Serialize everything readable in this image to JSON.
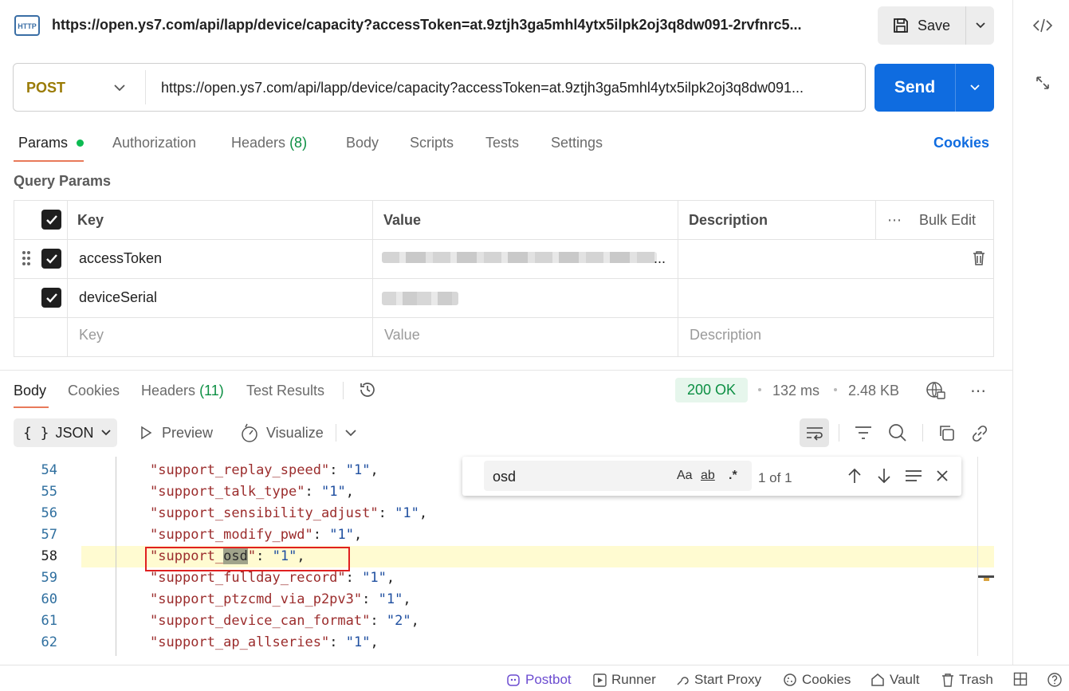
{
  "title_bar": {
    "url": "https://open.ys7.com/api/lapp/device/capacity?accessToken=at.9ztjh3ga5mhl4ytx5ilpk2oj3q8dw091-2rvfnrc5...",
    "badge_text": "HTTP",
    "save_label": "Save"
  },
  "request": {
    "method": "POST",
    "url": "https://open.ys7.com/api/lapp/device/capacity?accessToken=at.9ztjh3ga5mhl4ytx5ilpk2oj3q8dw091...",
    "send_label": "Send"
  },
  "request_tabs": {
    "params": "Params",
    "authorization": "Authorization",
    "headers": "Headers",
    "headers_count": "(8)",
    "body": "Body",
    "scripts": "Scripts",
    "tests": "Tests",
    "settings": "Settings",
    "cookies": "Cookies"
  },
  "query_params": {
    "title": "Query Params",
    "headers": {
      "key": "Key",
      "value": "Value",
      "description": "Description",
      "bulk_edit": "Bulk Edit"
    },
    "rows": [
      {
        "key": "accessToken",
        "value_suffix": "..."
      },
      {
        "key": "deviceSerial"
      }
    ],
    "placeholder": {
      "key": "Key",
      "value": "Value",
      "description": "Description"
    }
  },
  "response": {
    "tabs": {
      "body": "Body",
      "cookies": "Cookies",
      "headers": "Headers",
      "headers_count": "(11)",
      "test_results": "Test Results"
    },
    "status": "200 OK",
    "time": "132 ms",
    "size": "2.48 KB",
    "format": "JSON",
    "preview": "Preview",
    "visualize": "Visualize"
  },
  "code_lines": [
    {
      "n": "54",
      "key": "support_replay_speed",
      "val": "1"
    },
    {
      "n": "55",
      "key": "support_talk_type",
      "val": "1"
    },
    {
      "n": "56",
      "key": "support_sensibility_adjust",
      "val": "1"
    },
    {
      "n": "57",
      "key": "support_modify_pwd",
      "val": "1"
    },
    {
      "n": "58",
      "key_prefix": "support_",
      "key_match": "osd",
      "val": "1"
    },
    {
      "n": "59",
      "key": "support_fullday_record",
      "val": "1"
    },
    {
      "n": "60",
      "key": "support_ptzcmd_via_p2pv3",
      "val": "1"
    },
    {
      "n": "61",
      "key": "support_device_can_format",
      "val": "2"
    },
    {
      "n": "62",
      "key": "support_ap_allseries",
      "val": "1"
    }
  ],
  "find_widget": {
    "query": "osd",
    "match_case": "Aa",
    "whole_word": "ab",
    "regex": ".*",
    "count": "1 of 1"
  },
  "status_bar": {
    "postbot": "Postbot",
    "runner": "Runner",
    "start_proxy": "Start Proxy",
    "cookies": "Cookies",
    "vault": "Vault",
    "trash": "Trash"
  },
  "colors": {
    "accent_blue": "#0f6ce0",
    "method_post": "#9a7b05",
    "status_green": "#0c8f43",
    "tab_underline": "#e87a5a",
    "highlight_box": "#e02020"
  }
}
